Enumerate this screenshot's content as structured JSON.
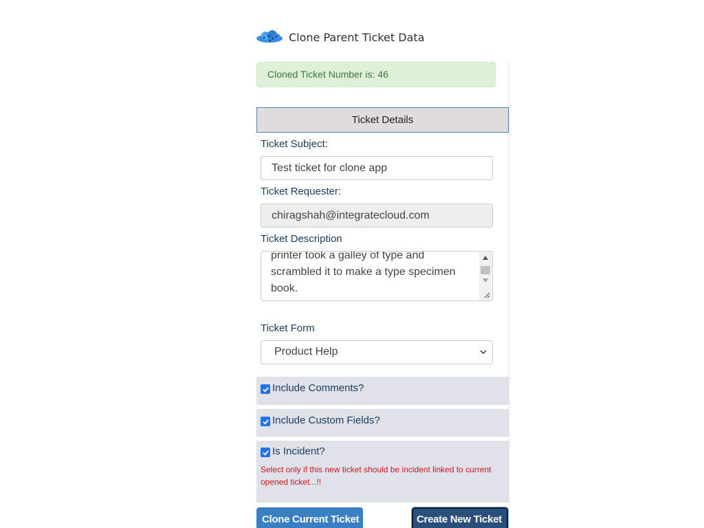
{
  "header": {
    "title": "Clone Parent Ticket Data",
    "logo_icon": "cloud-logo-icon"
  },
  "alert": {
    "message": "Cloned Ticket Number is: 46",
    "color": "#3c763d",
    "background": "#dff0d8"
  },
  "section": {
    "title": "Ticket Details"
  },
  "fields": {
    "subject_label": "Ticket Subject:",
    "subject_value": "Test ticket for clone app",
    "requester_label": "Ticket Requester:",
    "requester_value": "chiragshah@integratecloud.com",
    "description_label": "Ticket Description",
    "description_value": "printer took a galley of type and scrambled it to make a type specimen book.",
    "form_label": "Ticket Form",
    "form_selected": "Product Help"
  },
  "options": {
    "include_comments": {
      "label": "Include Comments?",
      "checked": true
    },
    "include_custom_fields": {
      "label": "Include Custom Fields?",
      "checked": true
    },
    "is_incident": {
      "label": "Is Incident?",
      "checked": true,
      "note": "Select only if this new ticket should be incident linked to current opened ticket...!!"
    }
  },
  "buttons": {
    "clone_label": "Clone Current Ticket",
    "create_label": "Create New Ticket"
  },
  "colors": {
    "accent": "#3a7fc1",
    "dark_button": "#2a4f7a",
    "checkbox": "#1e73e8",
    "warning": "#c9171e"
  }
}
